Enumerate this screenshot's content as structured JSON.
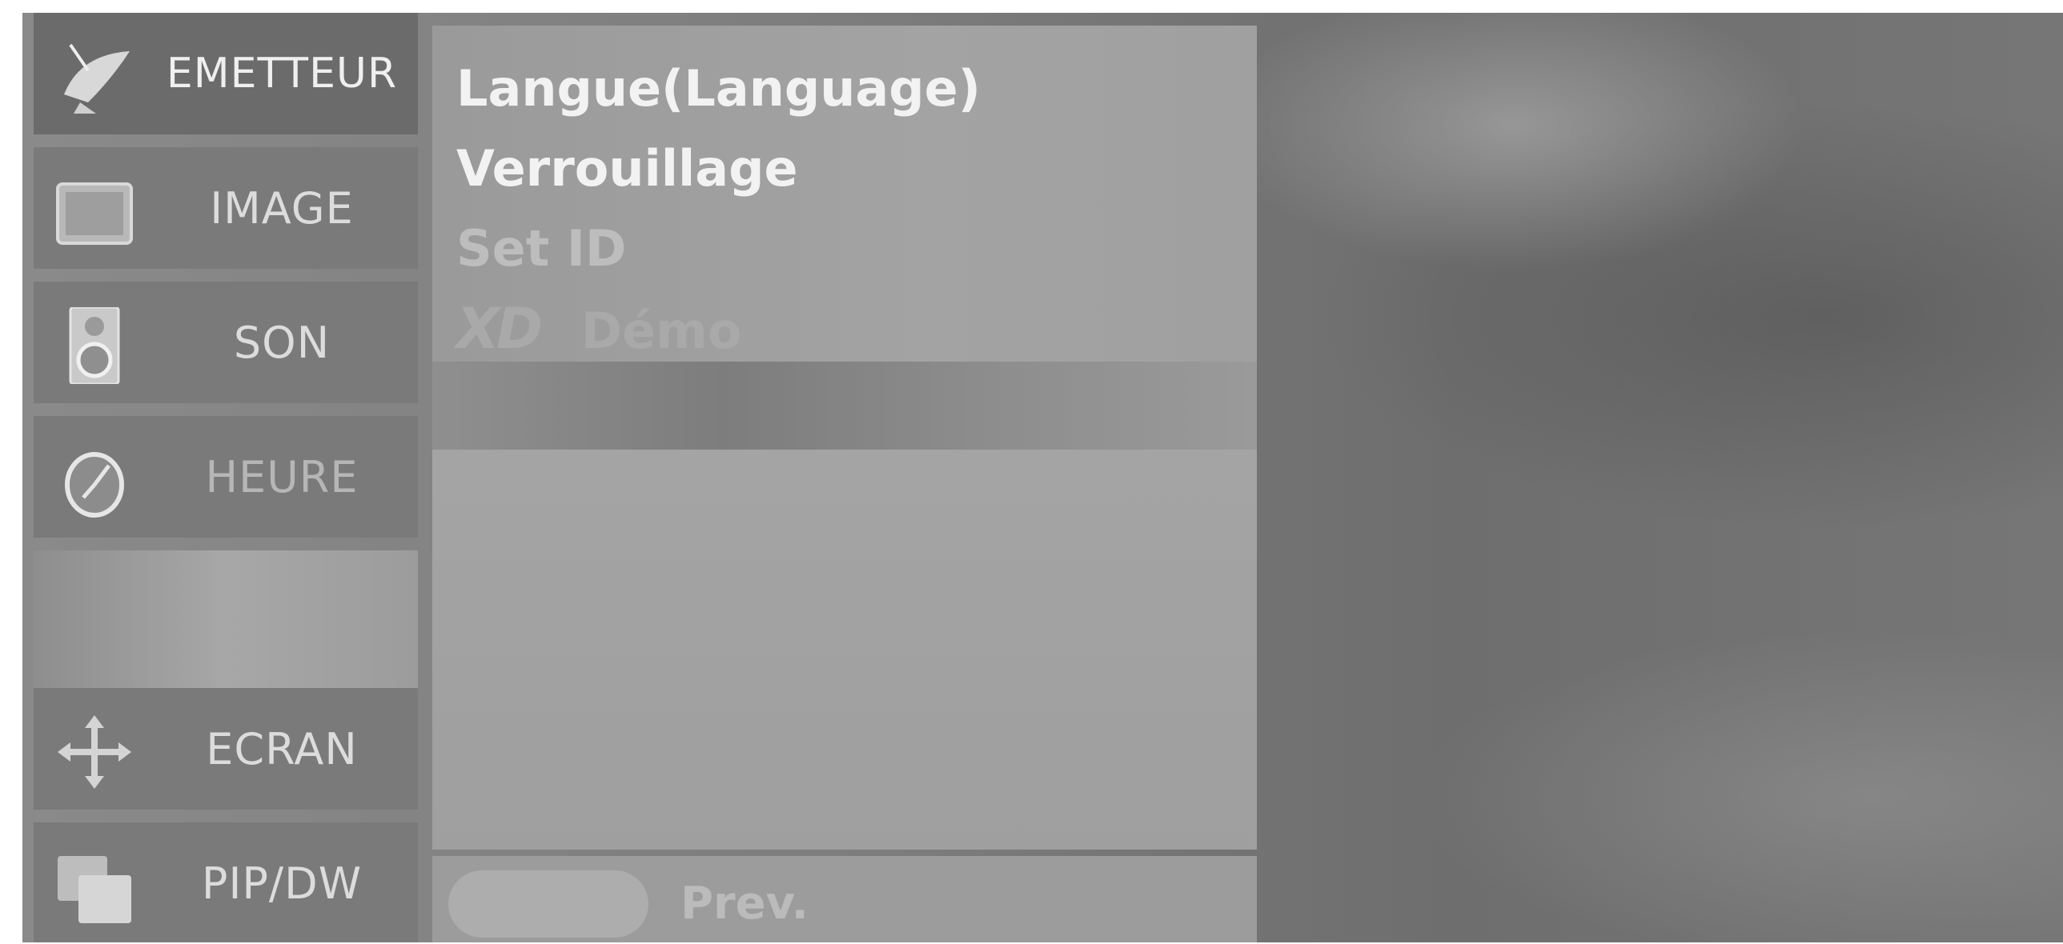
{
  "sidebar": {
    "items": [
      {
        "label": "EMETTEUR",
        "icon": "satellite-dish-icon",
        "state": "active"
      },
      {
        "label": "IMAGE",
        "icon": "picture-icon",
        "state": "normal"
      },
      {
        "label": "SON",
        "icon": "speaker-icon",
        "state": "normal"
      },
      {
        "label": "HEURE",
        "icon": "clock-icon",
        "state": "normal"
      },
      {
        "label": "ECRAN",
        "icon": "move-arrows-icon",
        "state": "normal"
      },
      {
        "label": "PIP/DW",
        "icon": "pip-window-icon",
        "state": "normal"
      }
    ]
  },
  "menu": {
    "items": [
      {
        "label": "Langue(Language)",
        "state": "enabled"
      },
      {
        "label": "Verrouillage",
        "state": "enabled"
      },
      {
        "label": "Set ID",
        "state": "disabled"
      },
      {
        "label": "Démo",
        "prefix": "XD",
        "state": "disabled"
      }
    ]
  },
  "footer": {
    "prev_label": "Prev."
  },
  "colors": {
    "panel": "#a0a0a0",
    "sidebar": "#7a7a7a",
    "text_active": "#f2f2f2",
    "text_disabled": "#bdbdbd"
  }
}
